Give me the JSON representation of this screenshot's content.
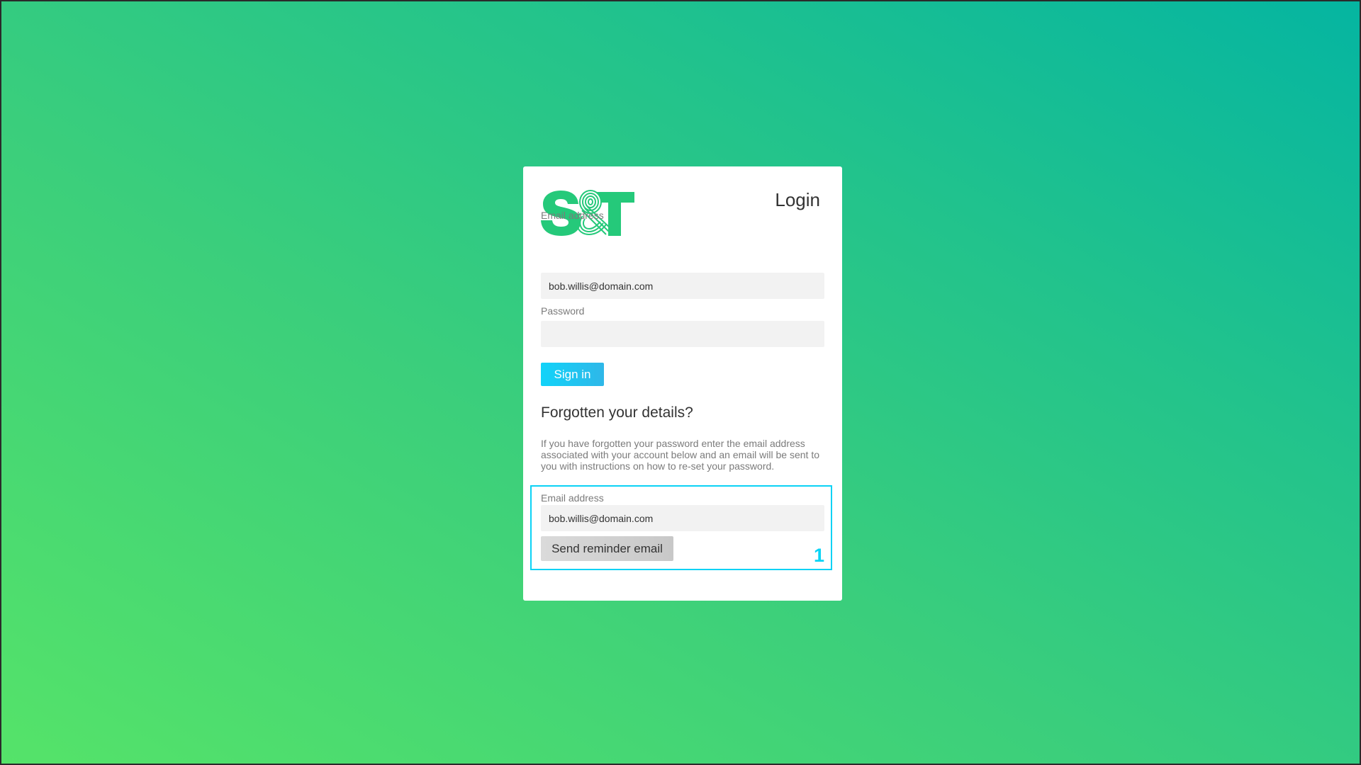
{
  "brand": {
    "logo_text": "S&T",
    "logo_color": "#25c97a"
  },
  "login": {
    "title": "Login",
    "email_label": "Email address",
    "email_value": "bob.willis@domain.com",
    "password_label": "Password",
    "password_value": "",
    "sign_in_label": "Sign in"
  },
  "forgot": {
    "heading": "Forgotten your details?",
    "description": "If you have forgotten your password enter the email address associated with your account below and an email will be sent to you with instructions on how to re-set your password.",
    "email_label": "Email address",
    "email_value": "bob.willis@domain.com",
    "send_label": "Send reminder email"
  },
  "annotation": {
    "step_number": "1",
    "color": "#0ad4f5"
  },
  "colors": {
    "gradient_start": "#55e369",
    "gradient_end": "#05b5a1",
    "primary_button": "#11d3f9"
  }
}
